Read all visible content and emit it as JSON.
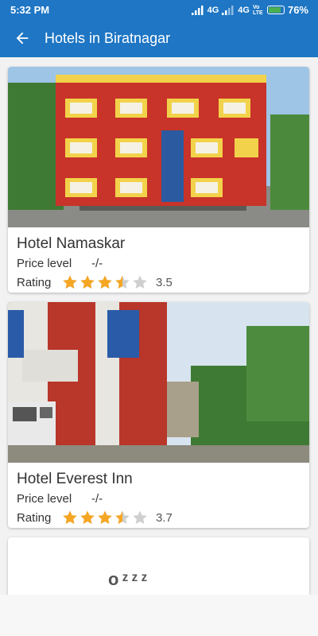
{
  "status": {
    "time": "5:32 PM",
    "net1": "4G",
    "net2": "4G",
    "volte": "Vo LTE",
    "battery": "76%"
  },
  "toolbar": {
    "title": "Hotels in Biratnagar",
    "back_icon": "arrow-left-icon"
  },
  "hotels": [
    {
      "name": "Hotel Namaskar",
      "price_label": "Price level",
      "price_value": "-/-",
      "rating_label": "Rating",
      "rating": 3.5,
      "rating_text": "3.5"
    },
    {
      "name": "Hotel Everest Inn",
      "price_label": "Price level",
      "price_value": "-/-",
      "rating_label": "Rating",
      "rating": 3.7,
      "rating_text": "3.7"
    }
  ],
  "placeholder": {
    "glyph": "oᶻᶻᶻ"
  },
  "colors": {
    "primary": "#1e76c4",
    "star": "#f5a623",
    "star_empty": "#cfcfcf"
  }
}
